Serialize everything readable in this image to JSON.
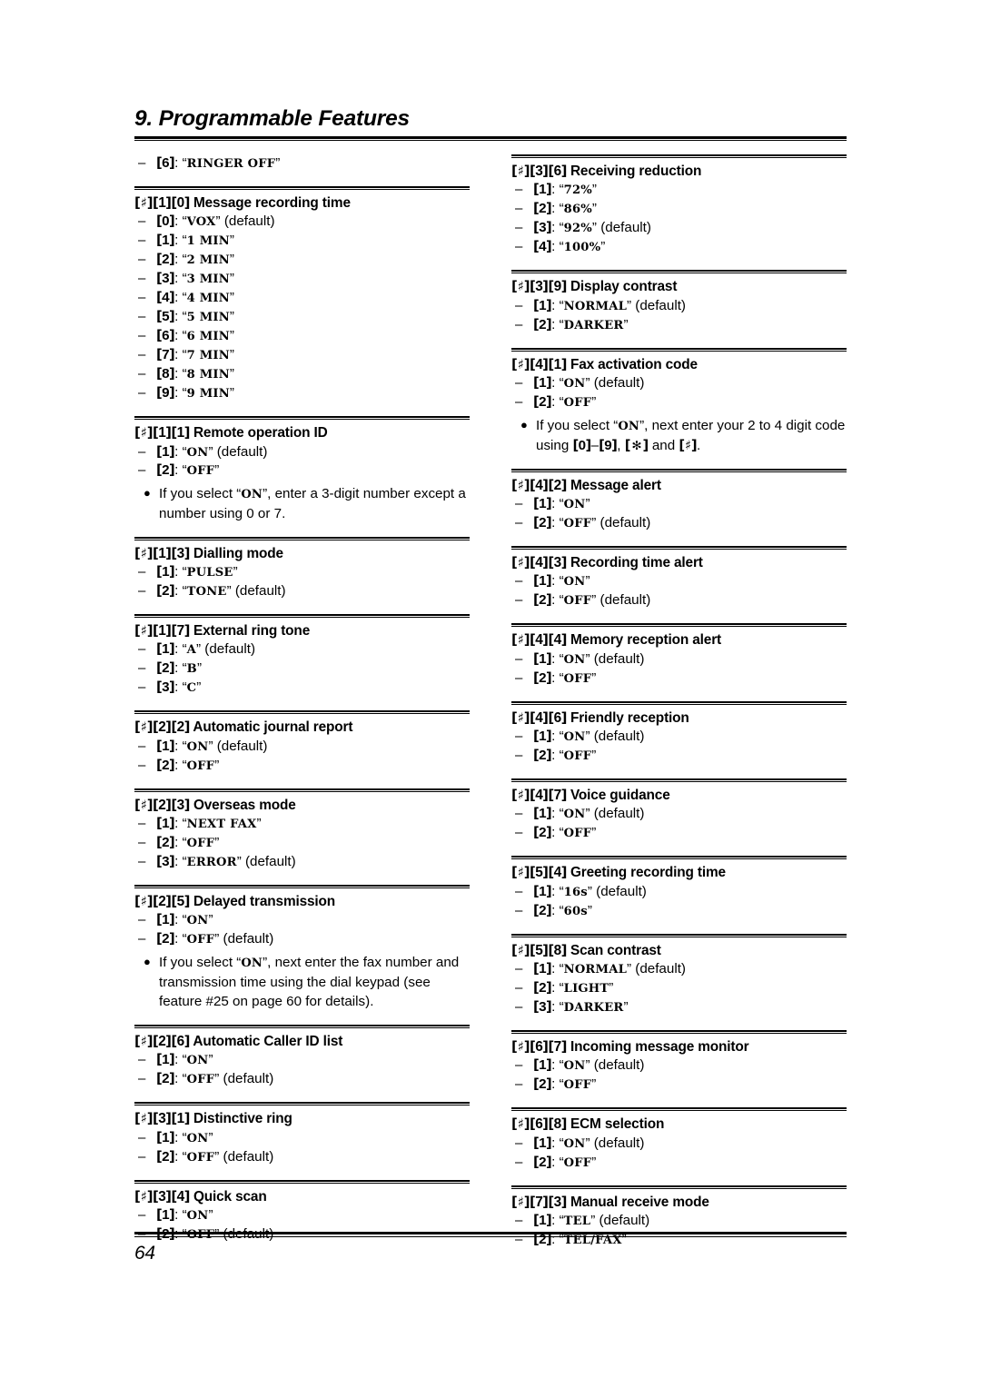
{
  "header": {
    "chapter_title": "9. Programmable Features"
  },
  "footer": {
    "page_number": "64"
  },
  "symbols": {
    "sharp": "♯",
    "star": "✻",
    "dash": "–",
    "bullet": "●",
    "open_bracket": "[",
    "close_bracket": "]",
    "open_quote": "“",
    "close_quote": "”"
  },
  "left_column": {
    "blocks": [
      {
        "type": "orphan_options",
        "rule_above": false,
        "options": [
          {
            "key": [
              "6"
            ],
            "value": "RINGER OFF",
            "default": false
          }
        ]
      },
      {
        "type": "feature",
        "keys": [
          "♯",
          "1",
          "0"
        ],
        "title": "Message recording time",
        "options": [
          {
            "key": [
              "0"
            ],
            "value": "VOX",
            "default": true
          },
          {
            "key": [
              "1"
            ],
            "value": "1 MIN",
            "default": false
          },
          {
            "key": [
              "2"
            ],
            "value": "2 MIN",
            "default": false
          },
          {
            "key": [
              "3"
            ],
            "value": "3 MIN",
            "default": false
          },
          {
            "key": [
              "4"
            ],
            "value": "4 MIN",
            "default": false
          },
          {
            "key": [
              "5"
            ],
            "value": "5 MIN",
            "default": false
          },
          {
            "key": [
              "6"
            ],
            "value": "6 MIN",
            "default": false
          },
          {
            "key": [
              "7"
            ],
            "value": "7 MIN",
            "default": false
          },
          {
            "key": [
              "8"
            ],
            "value": "8 MIN",
            "default": false
          },
          {
            "key": [
              "9"
            ],
            "value": "9 MIN",
            "default": false
          }
        ]
      },
      {
        "type": "feature",
        "keys": [
          "♯",
          "1",
          "1"
        ],
        "title": "Remote operation ID",
        "options": [
          {
            "key": [
              "1"
            ],
            "value": "ON",
            "default": true
          },
          {
            "key": [
              "2"
            ],
            "value": "OFF",
            "default": false
          }
        ],
        "notes": [
          {
            "segments": [
              {
                "t": "text",
                "v": "If you select “"
              },
              {
                "t": "lcd",
                "v": "ON"
              },
              {
                "t": "text",
                "v": "”, enter a 3-digit number except a number using 0 or 7."
              }
            ]
          }
        ]
      },
      {
        "type": "feature",
        "keys": [
          "♯",
          "1",
          "3"
        ],
        "title": "Dialling mode",
        "options": [
          {
            "key": [
              "1"
            ],
            "value": "PULSE",
            "default": false
          },
          {
            "key": [
              "2"
            ],
            "value": "TONE",
            "default": true
          }
        ]
      },
      {
        "type": "feature",
        "keys": [
          "♯",
          "1",
          "7"
        ],
        "title": "External ring tone",
        "options": [
          {
            "key": [
              "1"
            ],
            "value": "A",
            "default": true
          },
          {
            "key": [
              "2"
            ],
            "value": "B",
            "default": false
          },
          {
            "key": [
              "3"
            ],
            "value": "C",
            "default": false
          }
        ]
      },
      {
        "type": "feature",
        "keys": [
          "♯",
          "2",
          "2"
        ],
        "title": "Automatic journal report",
        "options": [
          {
            "key": [
              "1"
            ],
            "value": "ON",
            "default": true
          },
          {
            "key": [
              "2"
            ],
            "value": "OFF",
            "default": false
          }
        ]
      },
      {
        "type": "feature",
        "keys": [
          "♯",
          "2",
          "3"
        ],
        "title": "Overseas mode",
        "options": [
          {
            "key": [
              "1"
            ],
            "value": "NEXT FAX",
            "default": false
          },
          {
            "key": [
              "2"
            ],
            "value": "OFF",
            "default": false
          },
          {
            "key": [
              "3"
            ],
            "value": "ERROR",
            "default": true
          }
        ]
      },
      {
        "type": "feature",
        "keys": [
          "♯",
          "2",
          "5"
        ],
        "title": "Delayed transmission",
        "options": [
          {
            "key": [
              "1"
            ],
            "value": "ON",
            "default": false
          },
          {
            "key": [
              "2"
            ],
            "value": "OFF",
            "default": true
          }
        ],
        "notes": [
          {
            "segments": [
              {
                "t": "text",
                "v": "If you select “"
              },
              {
                "t": "lcd",
                "v": "ON"
              },
              {
                "t": "text",
                "v": "”, next enter the fax number and transmission time using the dial keypad (see feature #25 on page 60 for details)."
              }
            ]
          }
        ]
      },
      {
        "type": "feature",
        "keys": [
          "♯",
          "2",
          "6"
        ],
        "title": "Automatic Caller ID list",
        "options": [
          {
            "key": [
              "1"
            ],
            "value": "ON",
            "default": false
          },
          {
            "key": [
              "2"
            ],
            "value": "OFF",
            "default": true
          }
        ]
      },
      {
        "type": "feature",
        "keys": [
          "♯",
          "3",
          "1"
        ],
        "title": "Distinctive ring",
        "options": [
          {
            "key": [
              "1"
            ],
            "value": "ON",
            "default": false
          },
          {
            "key": [
              "2"
            ],
            "value": "OFF",
            "default": true
          }
        ]
      },
      {
        "type": "feature",
        "keys": [
          "♯",
          "3",
          "4"
        ],
        "title": "Quick scan",
        "options": [
          {
            "key": [
              "1"
            ],
            "value": "ON",
            "default": false
          },
          {
            "key": [
              "2"
            ],
            "value": "OFF",
            "default": true
          }
        ]
      }
    ]
  },
  "right_column": {
    "blocks": [
      {
        "type": "feature",
        "keys": [
          "♯",
          "3",
          "6"
        ],
        "title": "Receiving reduction",
        "options": [
          {
            "key": [
              "1"
            ],
            "value": "72%",
            "default": false
          },
          {
            "key": [
              "2"
            ],
            "value": "86%",
            "default": false
          },
          {
            "key": [
              "3"
            ],
            "value": "92%",
            "default": true
          },
          {
            "key": [
              "4"
            ],
            "value": "100%",
            "default": false
          }
        ]
      },
      {
        "type": "feature",
        "keys": [
          "♯",
          "3",
          "9"
        ],
        "title": "Display contrast",
        "options": [
          {
            "key": [
              "1"
            ],
            "value": "NORMAL",
            "default": true
          },
          {
            "key": [
              "2"
            ],
            "value": "DARKER",
            "default": false
          }
        ]
      },
      {
        "type": "feature",
        "keys": [
          "♯",
          "4",
          "1"
        ],
        "title": "Fax activation code",
        "options": [
          {
            "key": [
              "1"
            ],
            "value": "ON",
            "default": true
          },
          {
            "key": [
              "2"
            ],
            "value": "OFF",
            "default": false
          }
        ],
        "notes": [
          {
            "segments": [
              {
                "t": "text",
                "v": "If you select “"
              },
              {
                "t": "lcd",
                "v": "ON"
              },
              {
                "t": "text",
                "v": "”, next enter your 2 to 4 digit code using "
              },
              {
                "t": "key",
                "v": [
                  "0"
                ]
              },
              {
                "t": "text",
                "v": "–"
              },
              {
                "t": "key",
                "v": [
                  "9"
                ]
              },
              {
                "t": "text",
                "v": ", "
              },
              {
                "t": "key",
                "v": [
                  "✻"
                ]
              },
              {
                "t": "text",
                "v": " and "
              },
              {
                "t": "key",
                "v": [
                  "♯"
                ]
              },
              {
                "t": "text",
                "v": "."
              }
            ]
          }
        ]
      },
      {
        "type": "feature",
        "keys": [
          "♯",
          "4",
          "2"
        ],
        "title": "Message alert",
        "options": [
          {
            "key": [
              "1"
            ],
            "value": "ON",
            "default": false
          },
          {
            "key": [
              "2"
            ],
            "value": "OFF",
            "default": true
          }
        ]
      },
      {
        "type": "feature",
        "keys": [
          "♯",
          "4",
          "3"
        ],
        "title": "Recording time alert",
        "options": [
          {
            "key": [
              "1"
            ],
            "value": "ON",
            "default": false
          },
          {
            "key": [
              "2"
            ],
            "value": "OFF",
            "default": true
          }
        ]
      },
      {
        "type": "feature",
        "keys": [
          "♯",
          "4",
          "4"
        ],
        "title": "Memory reception alert",
        "options": [
          {
            "key": [
              "1"
            ],
            "value": "ON",
            "default": true
          },
          {
            "key": [
              "2"
            ],
            "value": "OFF",
            "default": false
          }
        ]
      },
      {
        "type": "feature",
        "keys": [
          "♯",
          "4",
          "6"
        ],
        "title": "Friendly reception",
        "options": [
          {
            "key": [
              "1"
            ],
            "value": "ON",
            "default": true
          },
          {
            "key": [
              "2"
            ],
            "value": "OFF",
            "default": false
          }
        ]
      },
      {
        "type": "feature",
        "keys": [
          "♯",
          "4",
          "7"
        ],
        "title": "Voice guidance",
        "options": [
          {
            "key": [
              "1"
            ],
            "value": "ON",
            "default": true
          },
          {
            "key": [
              "2"
            ],
            "value": "OFF",
            "default": false
          }
        ]
      },
      {
        "type": "feature",
        "keys": [
          "♯",
          "5",
          "4"
        ],
        "title": "Greeting recording time",
        "options": [
          {
            "key": [
              "1"
            ],
            "value": "16s",
            "default": true
          },
          {
            "key": [
              "2"
            ],
            "value": "60s",
            "default": false
          }
        ]
      },
      {
        "type": "feature",
        "keys": [
          "♯",
          "5",
          "8"
        ],
        "title": "Scan contrast",
        "options": [
          {
            "key": [
              "1"
            ],
            "value": "NORMAL",
            "default": true
          },
          {
            "key": [
              "2"
            ],
            "value": "LIGHT",
            "default": false
          },
          {
            "key": [
              "3"
            ],
            "value": "DARKER",
            "default": false
          }
        ]
      },
      {
        "type": "feature",
        "keys": [
          "♯",
          "6",
          "7"
        ],
        "title": "Incoming message monitor",
        "options": [
          {
            "key": [
              "1"
            ],
            "value": "ON",
            "default": true
          },
          {
            "key": [
              "2"
            ],
            "value": "OFF",
            "default": false
          }
        ]
      },
      {
        "type": "feature",
        "keys": [
          "♯",
          "6",
          "8"
        ],
        "title": "ECM selection",
        "options": [
          {
            "key": [
              "1"
            ],
            "value": "ON",
            "default": true
          },
          {
            "key": [
              "2"
            ],
            "value": "OFF",
            "default": false
          }
        ]
      },
      {
        "type": "feature",
        "keys": [
          "♯",
          "7",
          "3"
        ],
        "title": "Manual receive mode",
        "options": [
          {
            "key": [
              "1"
            ],
            "value": "TEL",
            "default": true
          },
          {
            "key": [
              "2"
            ],
            "value": "TEL/FAX",
            "default": false
          }
        ]
      }
    ]
  },
  "labels": {
    "default_suffix": "(default)"
  }
}
